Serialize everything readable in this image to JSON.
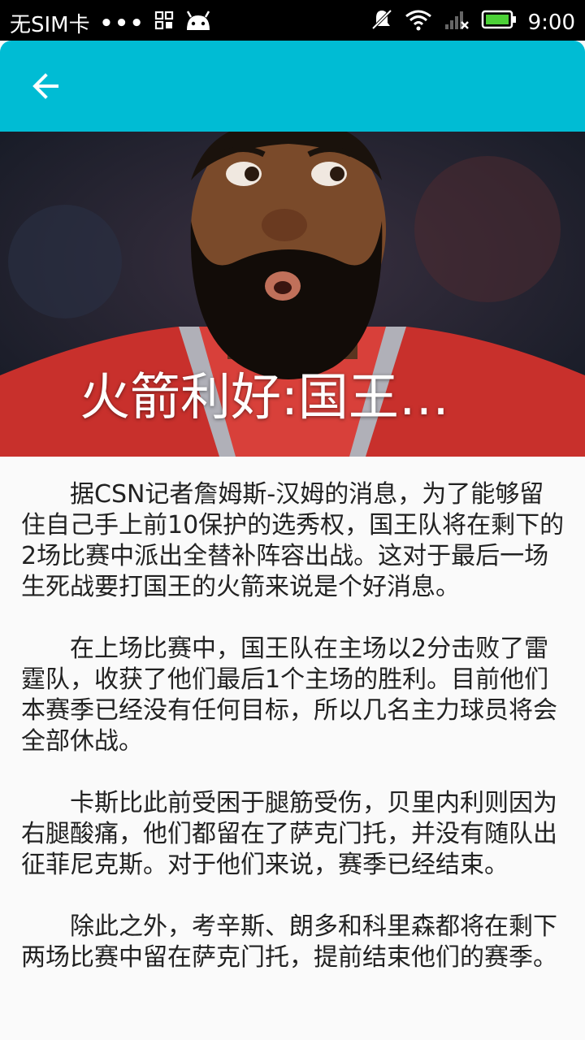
{
  "status_bar": {
    "carrier": "无SIM卡",
    "dots": "•••",
    "time": "9:00"
  },
  "app_bar": {
    "color": "#00bcd4",
    "back_icon": "arrow-back-icon"
  },
  "hero": {
    "title": "火箭利好:国王…"
  },
  "article": {
    "paragraphs": [
      "据CSN记者詹姆斯-汉姆的消息，为了能够留住自己手上前10保护的选秀权，国王队将在剩下的2场比赛中派出全替补阵容出战。这对于最后一场生死战要打国王的火箭来说是个好消息。",
      "在上场比赛中，国王队在主场以2分击败了雷霆队，收获了他们最后1个主场的胜利。目前他们本赛季已经没有任何目标，所以几名主力球员将会全部休战。",
      "卡斯比此前受困于腿筋受伤，贝里内利则因为右腿酸痛，他们都留在了萨克门托，并没有随队出征菲尼克斯。对于他们来说，赛季已经结束。",
      "除此之外，考辛斯、朗多和科里森都将在剩下两场比赛中留在萨克门托，提前结束他们的赛季。"
    ]
  }
}
